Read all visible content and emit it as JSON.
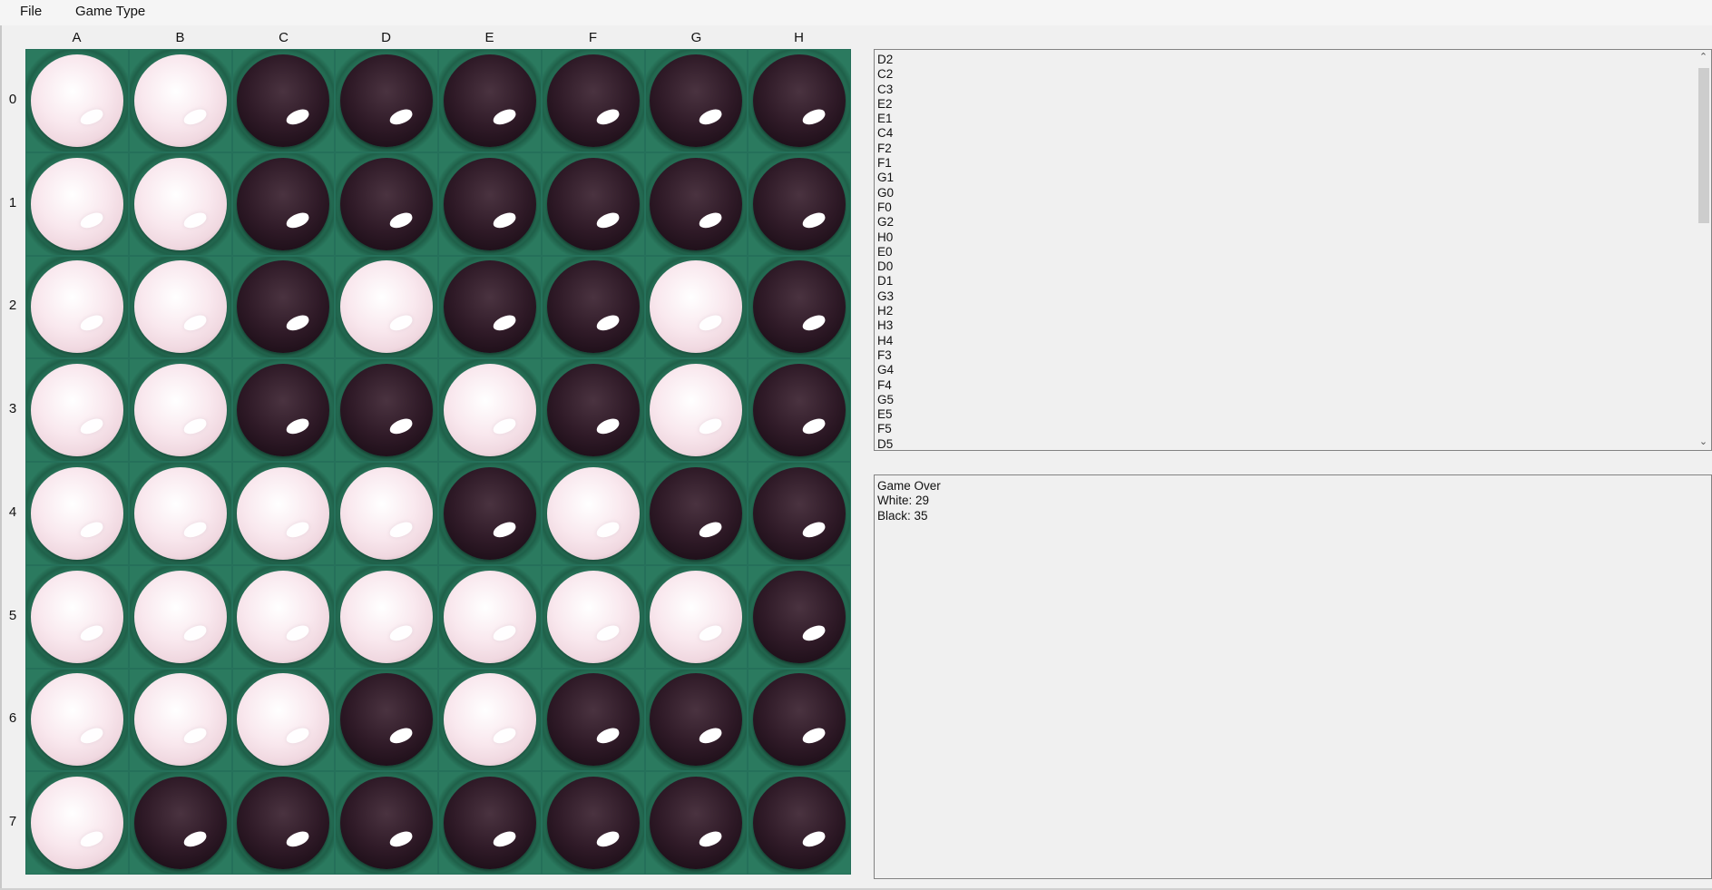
{
  "menu": {
    "file": "File",
    "game_type": "Game Type"
  },
  "board": {
    "columns": [
      "A",
      "B",
      "C",
      "D",
      "E",
      "F",
      "G",
      "H"
    ],
    "rows": [
      "0",
      "1",
      "2",
      "3",
      "4",
      "5",
      "6",
      "7"
    ],
    "cells": [
      [
        "white",
        "white",
        "black",
        "black",
        "black",
        "black",
        "black",
        "black"
      ],
      [
        "white",
        "white",
        "black",
        "black",
        "black",
        "black",
        "black",
        "black"
      ],
      [
        "white",
        "white",
        "black",
        "white",
        "black",
        "black",
        "white",
        "black"
      ],
      [
        "white",
        "white",
        "black",
        "black",
        "white",
        "black",
        "white",
        "black"
      ],
      [
        "white",
        "white",
        "white",
        "white",
        "black",
        "white",
        "black",
        "black"
      ],
      [
        "white",
        "white",
        "white",
        "white",
        "white",
        "white",
        "white",
        "black"
      ],
      [
        "white",
        "white",
        "white",
        "black",
        "white",
        "black",
        "black",
        "black"
      ],
      [
        "white",
        "black",
        "black",
        "black",
        "black",
        "black",
        "black",
        "black"
      ]
    ]
  },
  "move_list": [
    "D2",
    "C2",
    "C3",
    "E2",
    "E1",
    "C4",
    "F2",
    "F1",
    "G1",
    "G0",
    "F0",
    "G2",
    "H0",
    "E0",
    "D0",
    "D1",
    "G3",
    "H2",
    "H3",
    "H4",
    "F3",
    "G4",
    "F4",
    "G5",
    "E5",
    "F5",
    "D5"
  ],
  "status": {
    "title": "Game Over",
    "white": "White: 29",
    "black": "Black: 35"
  },
  "colors": {
    "board_felt": "#2a7a5f",
    "white_disc": "#f9e8ee",
    "black_disc": "#2f1a27"
  }
}
